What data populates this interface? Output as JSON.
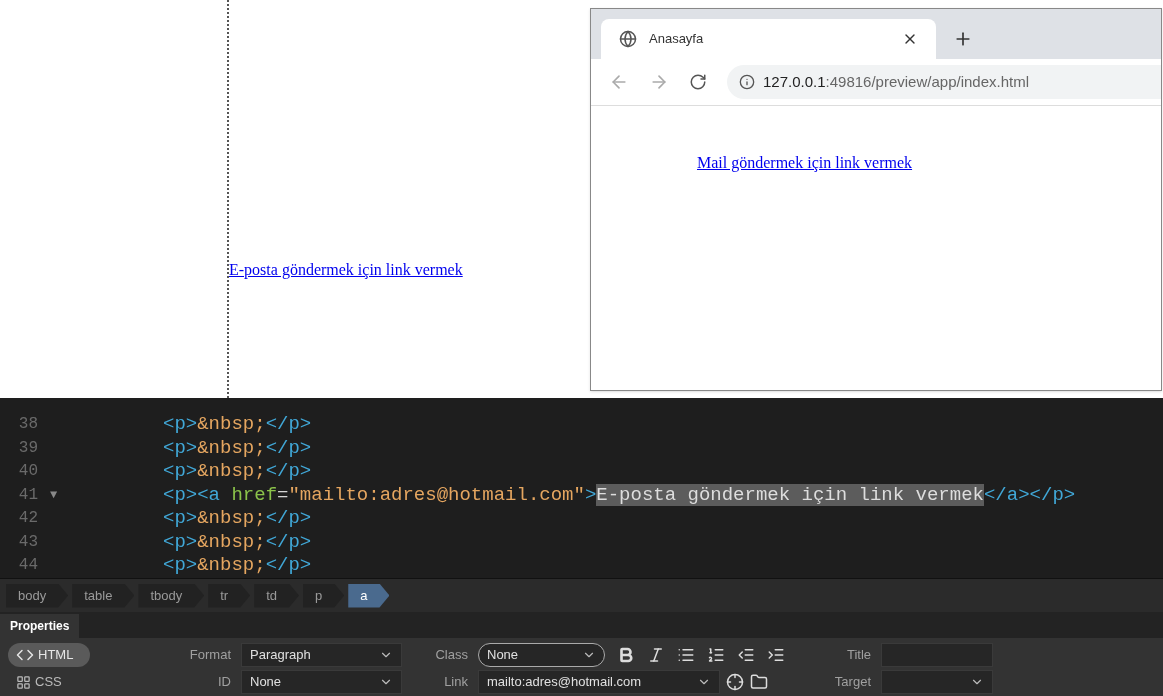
{
  "design_view": {
    "link_text": "E-posta göndermek için link vermek"
  },
  "browser": {
    "tab_title": "Anasayfa",
    "url_host": "127.0.0.1",
    "url_path": ":49816/preview/app/index.html",
    "page_link": "Mail göndermek için link vermek"
  },
  "code_lines": [
    {
      "number": "38",
      "tokens": [
        {
          "kind": "tag",
          "text": "<p>"
        },
        {
          "kind": "entity",
          "text": "&nbsp;"
        },
        {
          "kind": "tag",
          "text": "</p>"
        }
      ]
    },
    {
      "number": "39",
      "tokens": [
        {
          "kind": "tag",
          "text": "<p>"
        },
        {
          "kind": "entity",
          "text": "&nbsp;"
        },
        {
          "kind": "tag",
          "text": "</p>"
        }
      ]
    },
    {
      "number": "40",
      "tokens": [
        {
          "kind": "tag",
          "text": "<p>"
        },
        {
          "kind": "entity",
          "text": "&nbsp;"
        },
        {
          "kind": "tag",
          "text": "</p>"
        }
      ]
    },
    {
      "number": "41",
      "fold": "▼",
      "tokens": [
        {
          "kind": "tag",
          "text": "<p><a "
        },
        {
          "kind": "attr",
          "text": "href"
        },
        {
          "kind": "plain",
          "text": "="
        },
        {
          "kind": "string",
          "text": "\"mailto:adres@hotmail.com\""
        },
        {
          "kind": "tag",
          "text": ">"
        },
        {
          "kind": "selected",
          "text": "E-posta göndermek için link vermek"
        },
        {
          "kind": "tag",
          "text": "</a></p>"
        }
      ]
    },
    {
      "number": "42",
      "tokens": [
        {
          "kind": "tag",
          "text": "<p>"
        },
        {
          "kind": "entity",
          "text": "&nbsp;"
        },
        {
          "kind": "tag",
          "text": "</p>"
        }
      ]
    },
    {
      "number": "43",
      "tokens": [
        {
          "kind": "tag",
          "text": "<p>"
        },
        {
          "kind": "entity",
          "text": "&nbsp;"
        },
        {
          "kind": "tag",
          "text": "</p>"
        }
      ]
    },
    {
      "number": "44",
      "tokens": [
        {
          "kind": "tag",
          "text": "<p>"
        },
        {
          "kind": "entity",
          "text": "&nbsp;"
        },
        {
          "kind": "tag",
          "text": "</p>"
        }
      ]
    }
  ],
  "breadcrumbs": [
    {
      "label": "body",
      "selected": false
    },
    {
      "label": "table",
      "selected": false
    },
    {
      "label": "tbody",
      "selected": false
    },
    {
      "label": "tr",
      "selected": false
    },
    {
      "label": "td",
      "selected": false
    },
    {
      "label": "p",
      "selected": false
    },
    {
      "label": "a",
      "selected": true
    }
  ],
  "properties": {
    "tab": "Properties",
    "modes": [
      {
        "label": "HTML",
        "selected": true
      },
      {
        "label": "CSS",
        "selected": false
      }
    ],
    "format": {
      "label": "Format",
      "value": "Paragraph"
    },
    "class": {
      "label": "Class",
      "value": "None"
    },
    "title": {
      "label": "Title"
    },
    "id": {
      "label": "ID",
      "value": "None"
    },
    "link": {
      "label": "Link",
      "value": "mailto:adres@hotmail.com"
    },
    "target": {
      "label": "Target"
    }
  }
}
